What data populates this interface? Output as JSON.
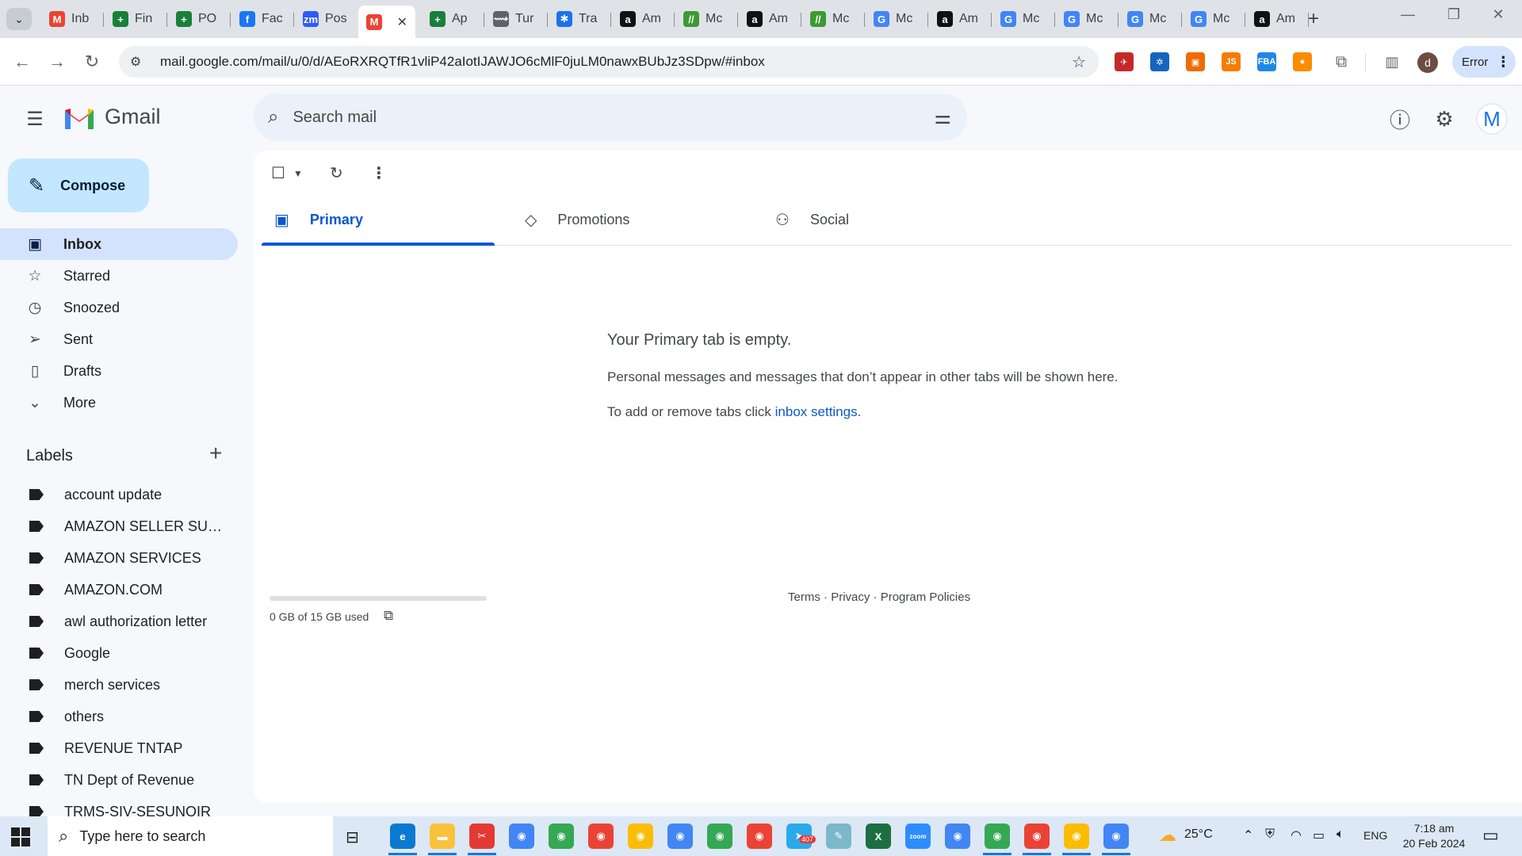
{
  "browser": {
    "tabs": [
      {
        "title": "Inb",
        "icon": "gmail-icon",
        "color": "#ea4335",
        "glyph": "M"
      },
      {
        "title": "Fin",
        "icon": "sheets-icon",
        "color": "#188038",
        "glyph": "+"
      },
      {
        "title": "PO",
        "icon": "sheets-icon",
        "color": "#188038",
        "glyph": "+"
      },
      {
        "title": "Fac",
        "icon": "facebook-icon",
        "color": "#1877f2",
        "glyph": "f"
      },
      {
        "title": "Pos",
        "icon": "zm-icon",
        "color": "#2d5cf6",
        "glyph": "zm"
      },
      {
        "title": "",
        "icon": "gmail-icon",
        "color": "#ea4335",
        "glyph": "M",
        "active": true
      },
      {
        "title": "Ap",
        "icon": "sheets-icon",
        "color": "#188038",
        "glyph": "+"
      },
      {
        "title": "Tur",
        "icon": "link-icon",
        "color": "#5f6368",
        "glyph": "⟿"
      },
      {
        "title": "Tra",
        "icon": "compass-icon",
        "color": "#1a73e8",
        "glyph": "✱"
      },
      {
        "title": "Am",
        "icon": "amazon-icon",
        "color": "#111111",
        "glyph": "a"
      },
      {
        "title": "Mc",
        "icon": "mc-icon",
        "color": "#3c9a32",
        "glyph": "//"
      },
      {
        "title": "Am",
        "icon": "amazon-icon",
        "color": "#111111",
        "glyph": "a"
      },
      {
        "title": "Mc",
        "icon": "mc-icon",
        "color": "#3c9a32",
        "glyph": "//"
      },
      {
        "title": "Mc",
        "icon": "google-icon",
        "color": "#4285f4",
        "glyph": "G"
      },
      {
        "title": "Am",
        "icon": "amazon-icon",
        "color": "#111111",
        "glyph": "a"
      },
      {
        "title": "Mc",
        "icon": "google-icon",
        "color": "#4285f4",
        "glyph": "G"
      },
      {
        "title": "Mc",
        "icon": "google-icon",
        "color": "#4285f4",
        "glyph": "G"
      },
      {
        "title": "Mc",
        "icon": "google-icon",
        "color": "#4285f4",
        "glyph": "G"
      },
      {
        "title": "Mc",
        "icon": "google-icon",
        "color": "#4285f4",
        "glyph": "G"
      },
      {
        "title": "Am",
        "icon": "amazon-icon",
        "color": "#111111",
        "glyph": "a"
      }
    ],
    "url": "mail.google.com/mail/u/0/d/AEoRXRQTfR1vliP42aIotIJAWJO6cMlF0juLM0nawxBUbJz3SDpw/#inbox",
    "error_label": "Error",
    "profile_initial": "d",
    "extensions": [
      {
        "name": "ext-red-icon",
        "color": "#c62828",
        "glyph": "✈"
      },
      {
        "name": "ext-blue-wheel-icon",
        "color": "#1565c0",
        "glyph": "✲"
      },
      {
        "name": "ext-orange-box-icon",
        "color": "#ef6c00",
        "glyph": "▣"
      },
      {
        "name": "ext-js-icon",
        "color": "#f57c00",
        "glyph": "JS"
      },
      {
        "name": "ext-fba-icon",
        "color": "#1e88e5",
        "glyph": "FBA"
      },
      {
        "name": "ext-orange-circle-icon",
        "color": "#fb8c00",
        "glyph": "●"
      }
    ]
  },
  "gmail": {
    "logo_text": "Gmail",
    "search_placeholder": "Search mail",
    "avatar_initial": "M",
    "compose_label": "Compose",
    "nav": [
      {
        "label": "Inbox",
        "icon": "inbox-icon",
        "glyph": "▣",
        "active": true
      },
      {
        "label": "Starred",
        "icon": "star-icon",
        "glyph": "☆"
      },
      {
        "label": "Snoozed",
        "icon": "clock-icon",
        "glyph": "◷"
      },
      {
        "label": "Sent",
        "icon": "send-icon",
        "glyph": "➢"
      },
      {
        "label": "Drafts",
        "icon": "draft-icon",
        "glyph": "▯"
      },
      {
        "label": "More",
        "icon": "chevron-down-icon",
        "glyph": "⌄"
      }
    ],
    "labels_title": "Labels",
    "labels": [
      "account update",
      "AMAZON SELLER SUPP...",
      "AMAZON SERVICES",
      "AMAZON.COM",
      "awl authorization letter",
      "Google",
      "merch services",
      "others",
      "REVENUE TNTAP",
      "TN Dept of Revenue",
      "TRMS-SIV-SESUNOIR"
    ],
    "categories": [
      {
        "label": "Primary",
        "icon": "inbox-icon",
        "glyph": "▣",
        "active": true
      },
      {
        "label": "Promotions",
        "icon": "tag-icon",
        "glyph": "◇"
      },
      {
        "label": "Social",
        "icon": "people-icon",
        "glyph": "⚇"
      }
    ],
    "empty": {
      "title": "Your Primary tab is empty.",
      "description": "Personal messages and messages that don’t appear in other tabs will be shown here.",
      "settings_prefix": "To add or remove tabs click ",
      "settings_link": "inbox settings",
      "settings_suffix": "."
    },
    "storage": {
      "text": "0 GB of 15 GB used",
      "used_fraction": 0.0
    },
    "footer": {
      "terms": "Terms",
      "privacy": "Privacy",
      "policies": "Program Policies",
      "sep": " · "
    }
  },
  "taskbar": {
    "search_placeholder": "Type here to search",
    "weather": "25°C",
    "language": "ENG",
    "time": "7:18 am",
    "date": "20 Feb 2024",
    "chrome_badge": "407"
  }
}
